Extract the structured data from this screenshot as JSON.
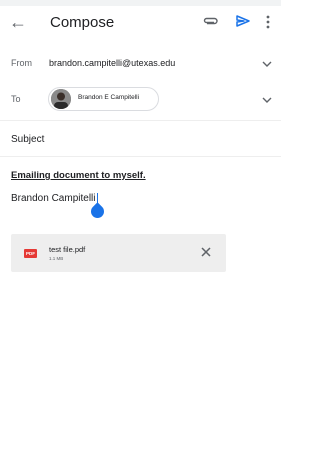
{
  "header": {
    "title": "Compose",
    "back_icon": "arrow-back-icon",
    "attach_icon": "paperclip-icon",
    "send_icon": "send-icon",
    "more_icon": "more-vert-icon",
    "accent": "#1a73e8"
  },
  "from": {
    "label": "From",
    "value": "brandon.campitelli@utexas.edu"
  },
  "to": {
    "label": "To",
    "recipient": "Brandon E Campitelli"
  },
  "subject": {
    "placeholder": "Subject"
  },
  "body": {
    "line1": "Emailing document to myself.",
    "line2": "Brandon Campitelli"
  },
  "attachment": {
    "name": "test file.pdf",
    "size": "1.1 MB",
    "type_label": "PDF"
  }
}
